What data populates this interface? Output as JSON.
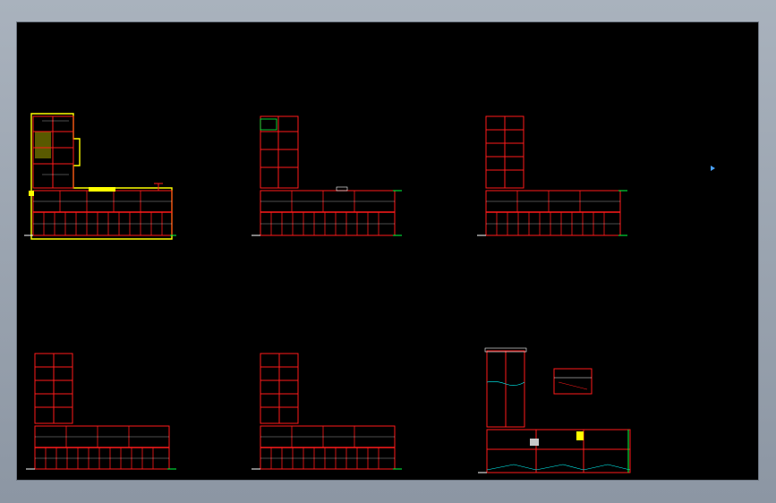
{
  "colors": {
    "background_outer": "#9aa3ae",
    "model_space": "#000000",
    "wall": "#ff1a1a",
    "grid_line": "#e0e0e0",
    "dimension": "#00ff40",
    "highlight": "#ffff00",
    "furniture": "#c8c8c8",
    "duct": "#00ffff"
  },
  "drawing": {
    "sheets": [
      {
        "id": "plan-1",
        "kind": "l-plan-highlighted"
      },
      {
        "id": "plan-2",
        "kind": "l-plan"
      },
      {
        "id": "plan-3",
        "kind": "l-plan"
      },
      {
        "id": "plan-4",
        "kind": "l-plan"
      },
      {
        "id": "plan-5",
        "kind": "l-plan"
      },
      {
        "id": "plan-6",
        "kind": "elevation-and-details"
      }
    ]
  }
}
